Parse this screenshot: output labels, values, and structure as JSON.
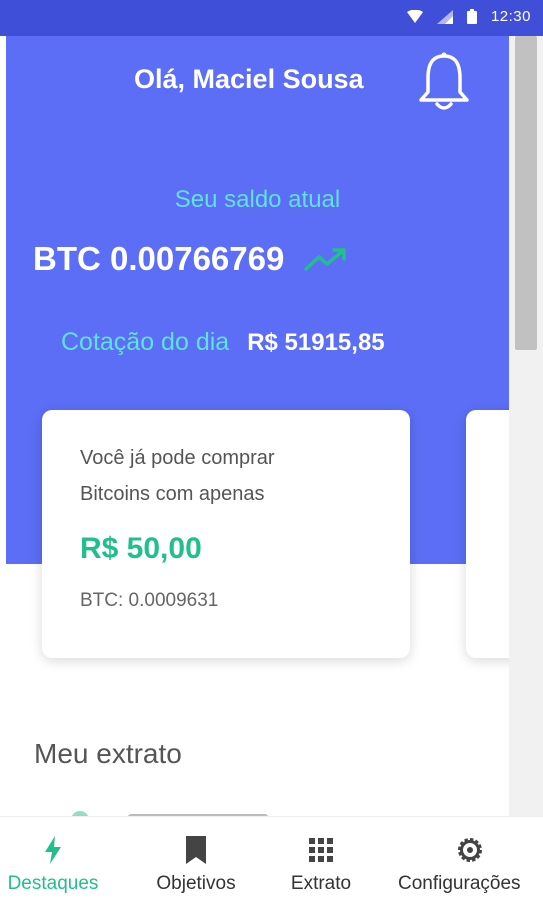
{
  "status_bar": {
    "time": "12:30"
  },
  "header": {
    "greeting": "Olá, Maciel Sousa",
    "balance_label": "Seu saldo atual",
    "balance_value": "BTC 0.00766769",
    "quote_label": "Cotação do dia",
    "quote_value": "R$ 51915,85"
  },
  "promo_card": {
    "line1": "Você já pode comprar",
    "line2": "Bitcoins com apenas",
    "price": "R$ 50,00",
    "btc": "BTC: 0.0009631"
  },
  "statement": {
    "title": "Meu extrato"
  },
  "nav": [
    {
      "label": "Destaques",
      "icon": "bolt-icon",
      "active": true
    },
    {
      "label": "Objetivos",
      "icon": "bookmark-icon",
      "active": false
    },
    {
      "label": "Extrato",
      "icon": "grid-icon",
      "active": false
    },
    {
      "label": "Configurações",
      "icon": "gear-icon",
      "active": false
    }
  ],
  "colors": {
    "primary": "#5b6ef5",
    "accent_cyan": "#5fe2dc",
    "accent_green": "#21c08b"
  }
}
